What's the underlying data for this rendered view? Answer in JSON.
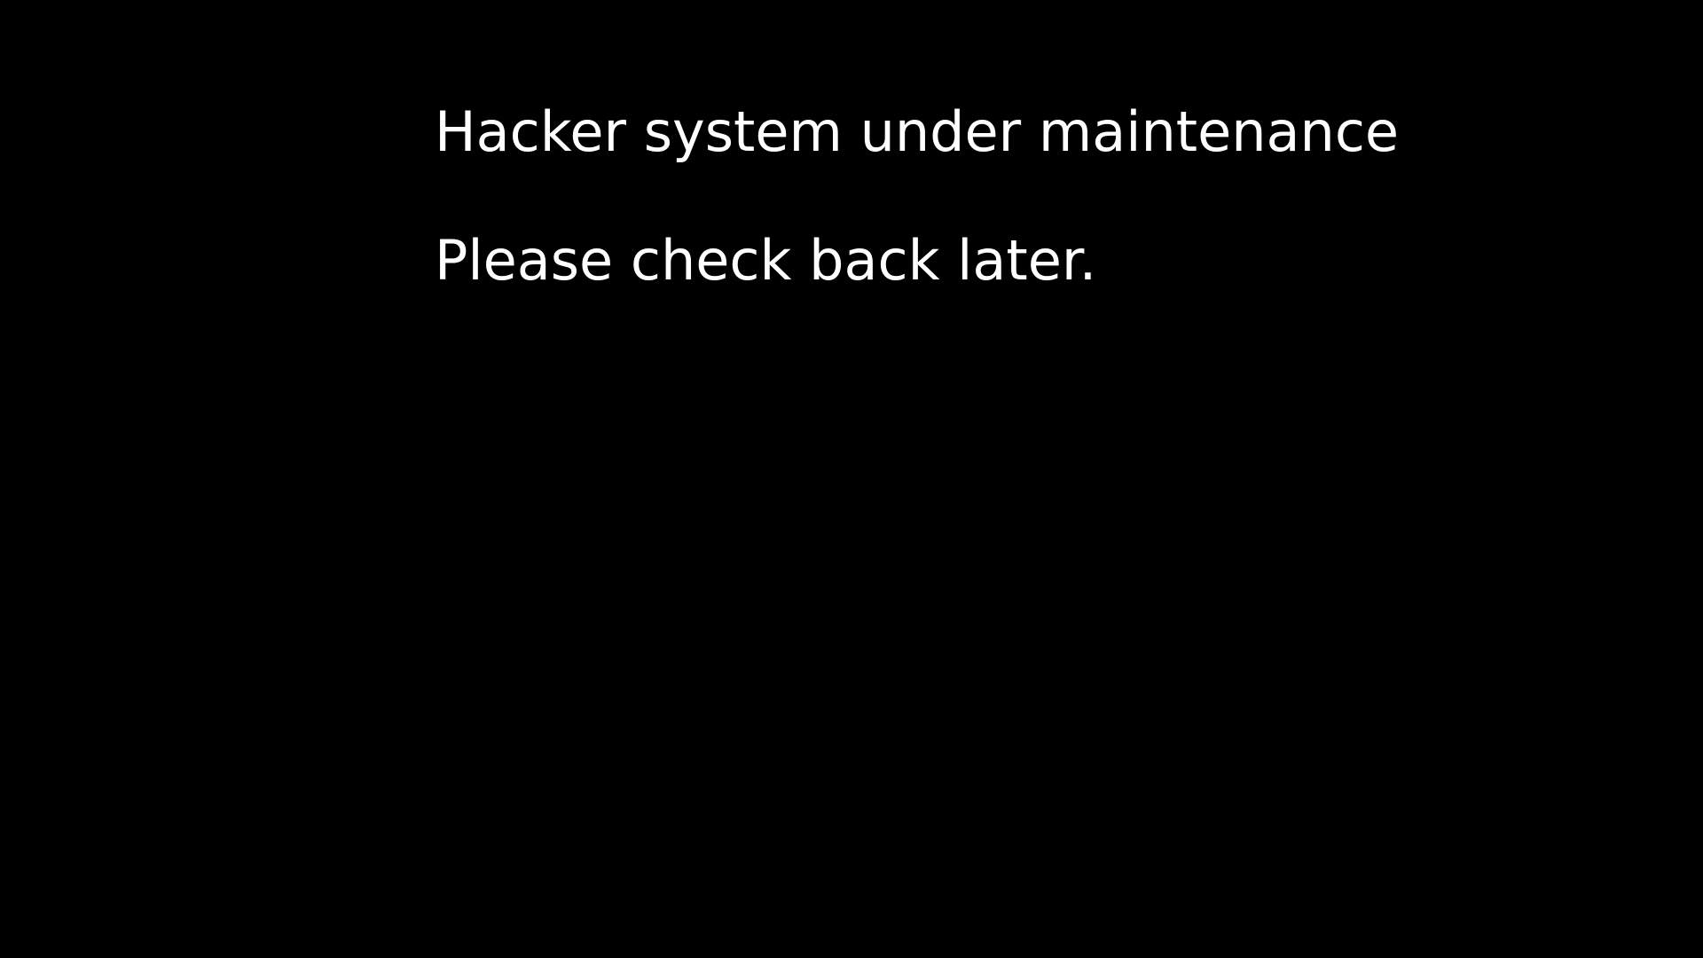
{
  "screen": {
    "background_color": "#000000",
    "text_color": "#ffffff",
    "heading": "Hacker system under maintenance",
    "subtext": "Please check back later."
  }
}
